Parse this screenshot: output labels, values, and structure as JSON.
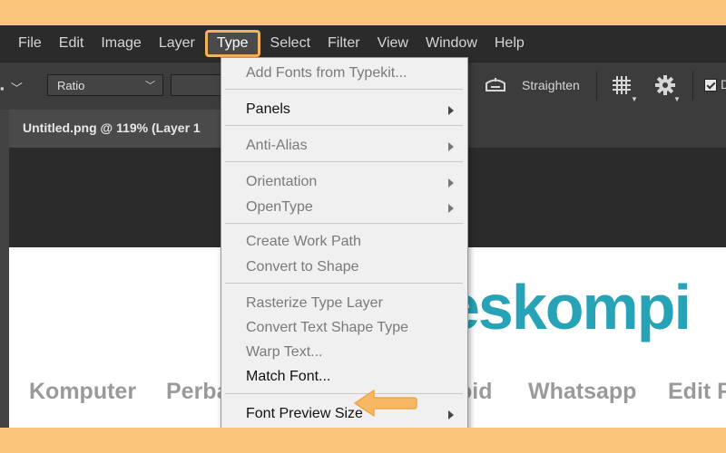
{
  "menubar": {
    "items": [
      "File",
      "Edit",
      "Image",
      "Layer",
      "Type",
      "Select",
      "Filter",
      "View",
      "Window",
      "Help"
    ],
    "active": "Type"
  },
  "options_bar": {
    "tool_chevron": "⌄",
    "ratio_select": "Ratio",
    "straighten_label": "Straighten",
    "checkbox_checked": true,
    "checkbox_label_partial": "D"
  },
  "document_tab": {
    "title": "Untitled.png @ 119% (Layer 1"
  },
  "canvas": {
    "logo_text": "eskompi",
    "logo_color": "#27A3B7",
    "nav_items": [
      "Komputer",
      "Perba",
      "oid",
      "Whatsapp",
      "Edit F"
    ]
  },
  "type_menu": {
    "items": [
      {
        "label": "Add Fonts from Typekit...",
        "enabled": false,
        "submenu": false
      },
      {
        "label": "Panels",
        "enabled": true,
        "submenu": true
      },
      {
        "label": "Anti-Alias",
        "enabled": false,
        "submenu": true
      },
      {
        "label": "Orientation",
        "enabled": false,
        "submenu": true
      },
      {
        "label": "OpenType",
        "enabled": false,
        "submenu": true
      },
      {
        "label": "Create Work Path",
        "enabled": false,
        "submenu": false
      },
      {
        "label": "Convert to Shape",
        "enabled": false,
        "submenu": false
      },
      {
        "label": "Rasterize Type Layer",
        "enabled": false,
        "submenu": false
      },
      {
        "label": "Convert Text Shape Type",
        "enabled": false,
        "submenu": false
      },
      {
        "label": "Warp Text...",
        "enabled": false,
        "submenu": false
      },
      {
        "label": "Match Font...",
        "enabled": true,
        "submenu": false
      },
      {
        "label": "Font Preview Size",
        "enabled": true,
        "submenu": true
      }
    ]
  },
  "colors": {
    "highlight": "#F3B35D",
    "border_background": "#F8C57A"
  },
  "icons": {
    "level": "horizon-level-icon",
    "grid": "grid-overlay-icon",
    "gear": "gear-icon",
    "pointer": "pointer-arrow-icon"
  }
}
